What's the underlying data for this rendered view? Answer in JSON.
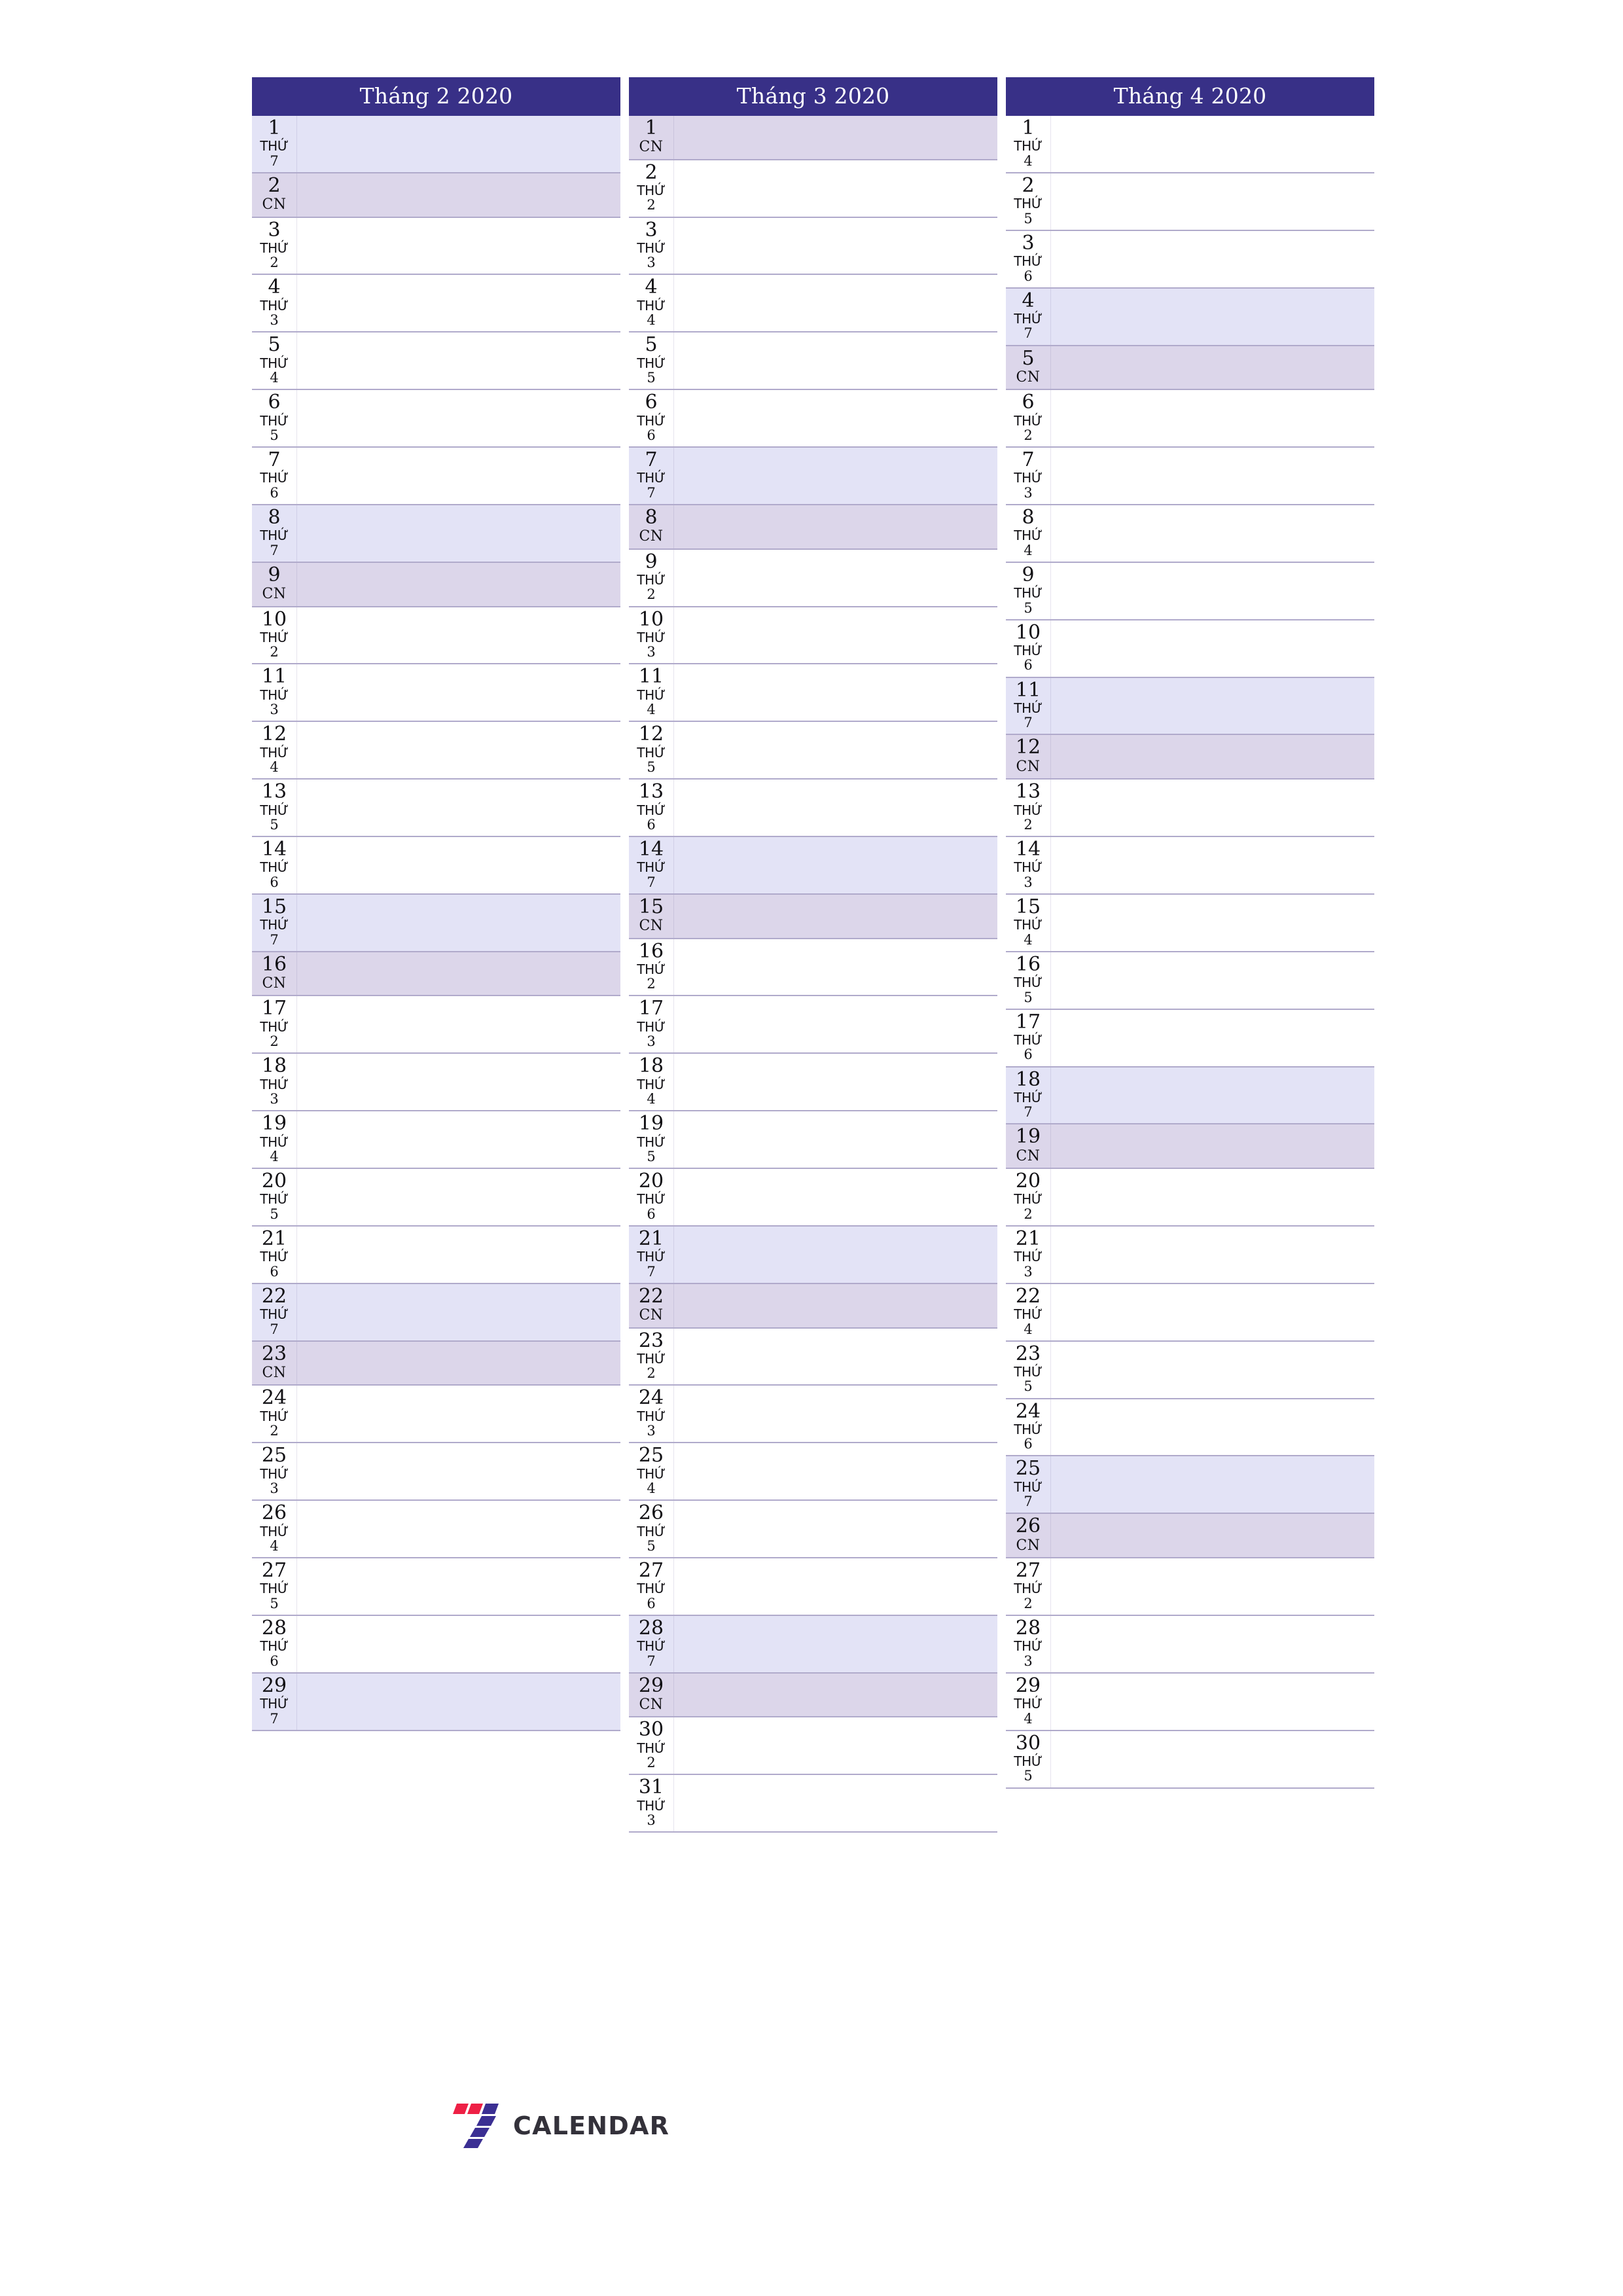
{
  "page": {
    "logo_text": "CALENDAR",
    "logo_colors": {
      "red": "#ee2045",
      "purple": "#3b2f93"
    },
    "header_bg": "#383087",
    "saturday_bg": "#e3e3f6",
    "sunday_bg": "#dcd6ea",
    "row_line": "#b0aacb"
  },
  "months": [
    {
      "title": "Tháng 2 2020",
      "days": [
        {
          "num": "1",
          "weekday_word": "THỨ",
          "weekday_num": "7",
          "type": "sat"
        },
        {
          "num": "2",
          "weekday_word": "CN",
          "weekday_num": "",
          "type": "sun"
        },
        {
          "num": "3",
          "weekday_word": "THỨ",
          "weekday_num": "2",
          "type": "weekday"
        },
        {
          "num": "4",
          "weekday_word": "THỨ",
          "weekday_num": "3",
          "type": "weekday"
        },
        {
          "num": "5",
          "weekday_word": "THỨ",
          "weekday_num": "4",
          "type": "weekday"
        },
        {
          "num": "6",
          "weekday_word": "THỨ",
          "weekday_num": "5",
          "type": "weekday"
        },
        {
          "num": "7",
          "weekday_word": "THỨ",
          "weekday_num": "6",
          "type": "weekday"
        },
        {
          "num": "8",
          "weekday_word": "THỨ",
          "weekday_num": "7",
          "type": "sat"
        },
        {
          "num": "9",
          "weekday_word": "CN",
          "weekday_num": "",
          "type": "sun"
        },
        {
          "num": "10",
          "weekday_word": "THỨ",
          "weekday_num": "2",
          "type": "weekday"
        },
        {
          "num": "11",
          "weekday_word": "THỨ",
          "weekday_num": "3",
          "type": "weekday"
        },
        {
          "num": "12",
          "weekday_word": "THỨ",
          "weekday_num": "4",
          "type": "weekday"
        },
        {
          "num": "13",
          "weekday_word": "THỨ",
          "weekday_num": "5",
          "type": "weekday"
        },
        {
          "num": "14",
          "weekday_word": "THỨ",
          "weekday_num": "6",
          "type": "weekday"
        },
        {
          "num": "15",
          "weekday_word": "THỨ",
          "weekday_num": "7",
          "type": "sat"
        },
        {
          "num": "16",
          "weekday_word": "CN",
          "weekday_num": "",
          "type": "sun"
        },
        {
          "num": "17",
          "weekday_word": "THỨ",
          "weekday_num": "2",
          "type": "weekday"
        },
        {
          "num": "18",
          "weekday_word": "THỨ",
          "weekday_num": "3",
          "type": "weekday"
        },
        {
          "num": "19",
          "weekday_word": "THỨ",
          "weekday_num": "4",
          "type": "weekday"
        },
        {
          "num": "20",
          "weekday_word": "THỨ",
          "weekday_num": "5",
          "type": "weekday"
        },
        {
          "num": "21",
          "weekday_word": "THỨ",
          "weekday_num": "6",
          "type": "weekday"
        },
        {
          "num": "22",
          "weekday_word": "THỨ",
          "weekday_num": "7",
          "type": "sat"
        },
        {
          "num": "23",
          "weekday_word": "CN",
          "weekday_num": "",
          "type": "sun"
        },
        {
          "num": "24",
          "weekday_word": "THỨ",
          "weekday_num": "2",
          "type": "weekday"
        },
        {
          "num": "25",
          "weekday_word": "THỨ",
          "weekday_num": "3",
          "type": "weekday"
        },
        {
          "num": "26",
          "weekday_word": "THỨ",
          "weekday_num": "4",
          "type": "weekday"
        },
        {
          "num": "27",
          "weekday_word": "THỨ",
          "weekday_num": "5",
          "type": "weekday"
        },
        {
          "num": "28",
          "weekday_word": "THỨ",
          "weekday_num": "6",
          "type": "weekday"
        },
        {
          "num": "29",
          "weekday_word": "THỨ",
          "weekday_num": "7",
          "type": "sat"
        }
      ]
    },
    {
      "title": "Tháng 3 2020",
      "days": [
        {
          "num": "1",
          "weekday_word": "CN",
          "weekday_num": "",
          "type": "sun"
        },
        {
          "num": "2",
          "weekday_word": "THỨ",
          "weekday_num": "2",
          "type": "weekday"
        },
        {
          "num": "3",
          "weekday_word": "THỨ",
          "weekday_num": "3",
          "type": "weekday"
        },
        {
          "num": "4",
          "weekday_word": "THỨ",
          "weekday_num": "4",
          "type": "weekday"
        },
        {
          "num": "5",
          "weekday_word": "THỨ",
          "weekday_num": "5",
          "type": "weekday"
        },
        {
          "num": "6",
          "weekday_word": "THỨ",
          "weekday_num": "6",
          "type": "weekday"
        },
        {
          "num": "7",
          "weekday_word": "THỨ",
          "weekday_num": "7",
          "type": "sat"
        },
        {
          "num": "8",
          "weekday_word": "CN",
          "weekday_num": "",
          "type": "sun"
        },
        {
          "num": "9",
          "weekday_word": "THỨ",
          "weekday_num": "2",
          "type": "weekday"
        },
        {
          "num": "10",
          "weekday_word": "THỨ",
          "weekday_num": "3",
          "type": "weekday"
        },
        {
          "num": "11",
          "weekday_word": "THỨ",
          "weekday_num": "4",
          "type": "weekday"
        },
        {
          "num": "12",
          "weekday_word": "THỨ",
          "weekday_num": "5",
          "type": "weekday"
        },
        {
          "num": "13",
          "weekday_word": "THỨ",
          "weekday_num": "6",
          "type": "weekday"
        },
        {
          "num": "14",
          "weekday_word": "THỨ",
          "weekday_num": "7",
          "type": "sat"
        },
        {
          "num": "15",
          "weekday_word": "CN",
          "weekday_num": "",
          "type": "sun"
        },
        {
          "num": "16",
          "weekday_word": "THỨ",
          "weekday_num": "2",
          "type": "weekday"
        },
        {
          "num": "17",
          "weekday_word": "THỨ",
          "weekday_num": "3",
          "type": "weekday"
        },
        {
          "num": "18",
          "weekday_word": "THỨ",
          "weekday_num": "4",
          "type": "weekday"
        },
        {
          "num": "19",
          "weekday_word": "THỨ",
          "weekday_num": "5",
          "type": "weekday"
        },
        {
          "num": "20",
          "weekday_word": "THỨ",
          "weekday_num": "6",
          "type": "weekday"
        },
        {
          "num": "21",
          "weekday_word": "THỨ",
          "weekday_num": "7",
          "type": "sat"
        },
        {
          "num": "22",
          "weekday_word": "CN",
          "weekday_num": "",
          "type": "sun"
        },
        {
          "num": "23",
          "weekday_word": "THỨ",
          "weekday_num": "2",
          "type": "weekday"
        },
        {
          "num": "24",
          "weekday_word": "THỨ",
          "weekday_num": "3",
          "type": "weekday"
        },
        {
          "num": "25",
          "weekday_word": "THỨ",
          "weekday_num": "4",
          "type": "weekday"
        },
        {
          "num": "26",
          "weekday_word": "THỨ",
          "weekday_num": "5",
          "type": "weekday"
        },
        {
          "num": "27",
          "weekday_word": "THỨ",
          "weekday_num": "6",
          "type": "weekday"
        },
        {
          "num": "28",
          "weekday_word": "THỨ",
          "weekday_num": "7",
          "type": "sat"
        },
        {
          "num": "29",
          "weekday_word": "CN",
          "weekday_num": "",
          "type": "sun"
        },
        {
          "num": "30",
          "weekday_word": "THỨ",
          "weekday_num": "2",
          "type": "weekday"
        },
        {
          "num": "31",
          "weekday_word": "THỨ",
          "weekday_num": "3",
          "type": "weekday"
        }
      ]
    },
    {
      "title": "Tháng 4 2020",
      "days": [
        {
          "num": "1",
          "weekday_word": "THỨ",
          "weekday_num": "4",
          "type": "weekday"
        },
        {
          "num": "2",
          "weekday_word": "THỨ",
          "weekday_num": "5",
          "type": "weekday"
        },
        {
          "num": "3",
          "weekday_word": "THỨ",
          "weekday_num": "6",
          "type": "weekday"
        },
        {
          "num": "4",
          "weekday_word": "THỨ",
          "weekday_num": "7",
          "type": "sat"
        },
        {
          "num": "5",
          "weekday_word": "CN",
          "weekday_num": "",
          "type": "sun"
        },
        {
          "num": "6",
          "weekday_word": "THỨ",
          "weekday_num": "2",
          "type": "weekday"
        },
        {
          "num": "7",
          "weekday_word": "THỨ",
          "weekday_num": "3",
          "type": "weekday"
        },
        {
          "num": "8",
          "weekday_word": "THỨ",
          "weekday_num": "4",
          "type": "weekday"
        },
        {
          "num": "9",
          "weekday_word": "THỨ",
          "weekday_num": "5",
          "type": "weekday"
        },
        {
          "num": "10",
          "weekday_word": "THỨ",
          "weekday_num": "6",
          "type": "weekday"
        },
        {
          "num": "11",
          "weekday_word": "THỨ",
          "weekday_num": "7",
          "type": "sat"
        },
        {
          "num": "12",
          "weekday_word": "CN",
          "weekday_num": "",
          "type": "sun"
        },
        {
          "num": "13",
          "weekday_word": "THỨ",
          "weekday_num": "2",
          "type": "weekday"
        },
        {
          "num": "14",
          "weekday_word": "THỨ",
          "weekday_num": "3",
          "type": "weekday"
        },
        {
          "num": "15",
          "weekday_word": "THỨ",
          "weekday_num": "4",
          "type": "weekday"
        },
        {
          "num": "16",
          "weekday_word": "THỨ",
          "weekday_num": "5",
          "type": "weekday"
        },
        {
          "num": "17",
          "weekday_word": "THỨ",
          "weekday_num": "6",
          "type": "weekday"
        },
        {
          "num": "18",
          "weekday_word": "THỨ",
          "weekday_num": "7",
          "type": "sat"
        },
        {
          "num": "19",
          "weekday_word": "CN",
          "weekday_num": "",
          "type": "sun"
        },
        {
          "num": "20",
          "weekday_word": "THỨ",
          "weekday_num": "2",
          "type": "weekday"
        },
        {
          "num": "21",
          "weekday_word": "THỨ",
          "weekday_num": "3",
          "type": "weekday"
        },
        {
          "num": "22",
          "weekday_word": "THỨ",
          "weekday_num": "4",
          "type": "weekday"
        },
        {
          "num": "23",
          "weekday_word": "THỨ",
          "weekday_num": "5",
          "type": "weekday"
        },
        {
          "num": "24",
          "weekday_word": "THỨ",
          "weekday_num": "6",
          "type": "weekday"
        },
        {
          "num": "25",
          "weekday_word": "THỨ",
          "weekday_num": "7",
          "type": "sat"
        },
        {
          "num": "26",
          "weekday_word": "CN",
          "weekday_num": "",
          "type": "sun"
        },
        {
          "num": "27",
          "weekday_word": "THỨ",
          "weekday_num": "2",
          "type": "weekday"
        },
        {
          "num": "28",
          "weekday_word": "THỨ",
          "weekday_num": "3",
          "type": "weekday"
        },
        {
          "num": "29",
          "weekday_word": "THỨ",
          "weekday_num": "4",
          "type": "weekday"
        },
        {
          "num": "30",
          "weekday_word": "THỨ",
          "weekday_num": "5",
          "type": "weekday"
        }
      ]
    }
  ]
}
